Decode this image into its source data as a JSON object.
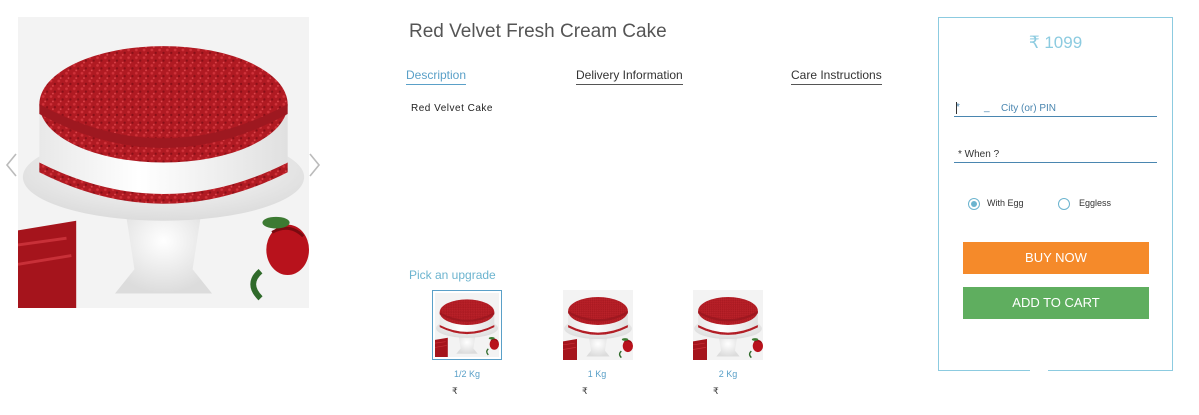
{
  "product": {
    "title": "Red Velvet Fresh Cream Cake",
    "tabs": [
      {
        "label": "Description",
        "active": true
      },
      {
        "label": "Delivery Information",
        "active": false
      },
      {
        "label": "Care Instructions",
        "active": false
      }
    ],
    "description": "Red Velvet Cake"
  },
  "gallery": {
    "prev_icon": "chevron-left-icon",
    "next_icon": "chevron-right-icon"
  },
  "upgrades": {
    "label": "Pick an upgrade",
    "options": [
      {
        "weight": "1/2 Kg",
        "currency": "₹",
        "selected": true
      },
      {
        "weight": "1 Kg",
        "currency": "₹",
        "selected": false
      },
      {
        "weight": "2 Kg",
        "currency": "₹",
        "selected": false
      }
    ]
  },
  "purchase": {
    "price": "₹ 1099",
    "city_field": {
      "required_mark": "*",
      "dash": "_",
      "placeholder": "City (or) PIN"
    },
    "when_field": {
      "placeholder": "* When ?"
    },
    "egg_options": [
      {
        "label": "With Egg",
        "checked": true
      },
      {
        "label": "Eggless",
        "checked": false
      }
    ],
    "buy_now_label": "BUY NOW",
    "add_to_cart_label": "ADD TO CART"
  },
  "colors": {
    "accent": "#5aa0c8",
    "panel_border": "#8ccbe0",
    "buy_now": "#f58a2a",
    "add_to_cart": "#5fae5f",
    "cake_red": "#b01a22"
  }
}
